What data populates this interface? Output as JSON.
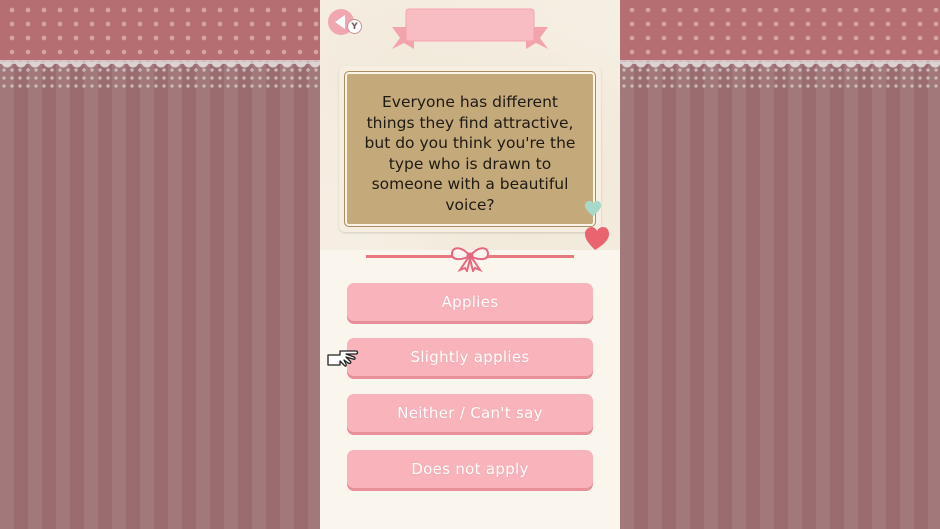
{
  "question": {
    "lines": [
      "Everyone has different",
      "things they find attractive,",
      "but do you think you're the",
      "type who is drawn to",
      "someone with a beautiful",
      "voice?"
    ]
  },
  "controls": {
    "back_badge": "Y",
    "back_icon": "back-arrow-icon"
  },
  "options": [
    {
      "label": "Applies"
    },
    {
      "label": "Slightly applies"
    },
    {
      "label": "Neither / Can't say"
    },
    {
      "label": "Does not apply"
    }
  ],
  "selected_option_index": 1,
  "colors": {
    "option_fill": "#f8b3bb",
    "card_fill": "#c4a97b",
    "accent": "#e7787e"
  }
}
